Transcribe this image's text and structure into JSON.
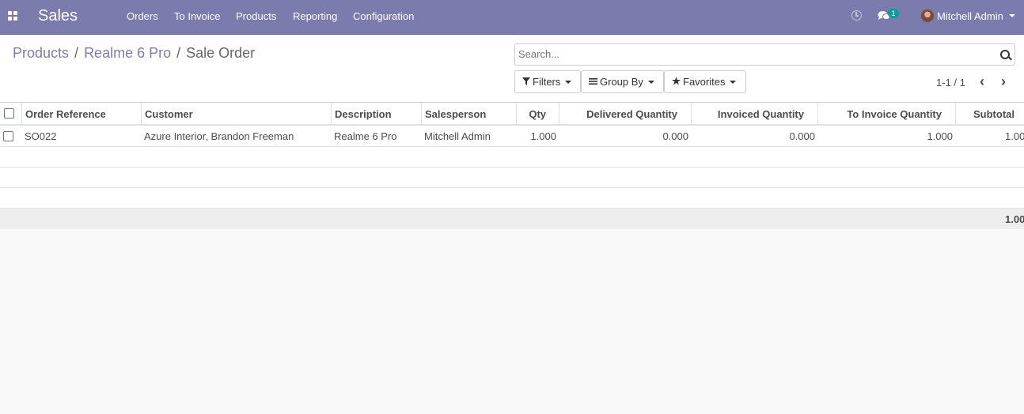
{
  "navbar": {
    "brand": "Sales",
    "menu": [
      "Orders",
      "To Invoice",
      "Products",
      "Reporting",
      "Configuration"
    ],
    "chat_badge": "1",
    "user_name": "Mitchell Admin",
    "accent_color": "#7c7bad"
  },
  "breadcrumb": {
    "items": [
      "Products",
      "Realme 6 Pro"
    ],
    "current": "Sale Order",
    "separator": "/"
  },
  "search": {
    "placeholder": "Search..."
  },
  "filters": {
    "filters_label": "Filters",
    "group_by_label": "Group By",
    "favorites_label": "Favorites"
  },
  "pager": {
    "value": "1-1 / 1"
  },
  "table": {
    "headers": [
      "Order Reference",
      "Customer",
      "Description",
      "Salesperson",
      "Qty",
      "Delivered Quantity",
      "Invoiced Quantity",
      "To Invoice Quantity",
      "Subtotal"
    ],
    "rows": [
      [
        "SO022",
        "Azure Interior, Brandon Freeman",
        "Realme 6 Pro",
        "Mitchell Admin",
        "1.000",
        "0.000",
        "0.000",
        "1.000",
        "1.00"
      ]
    ],
    "total": "1.00"
  }
}
